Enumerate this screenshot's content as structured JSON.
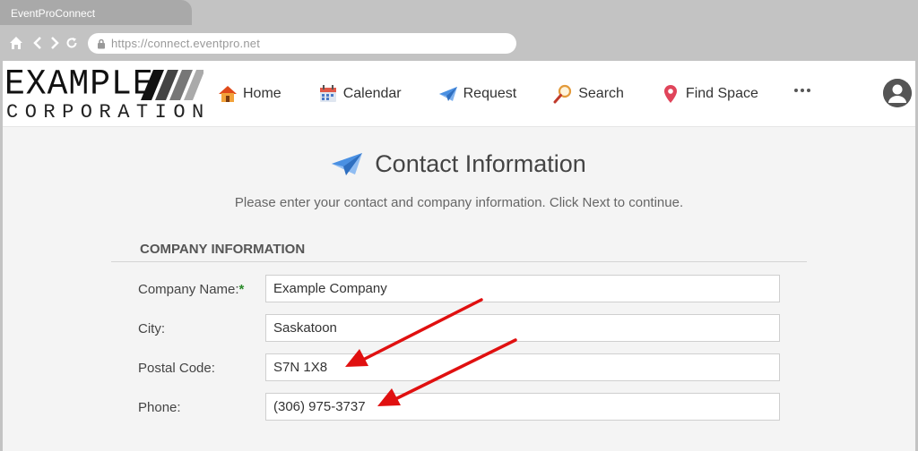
{
  "browser": {
    "tab_title": "EventProConnect",
    "url": "https://connect.eventpro.net"
  },
  "logo": {
    "line1": "EXAMPLE",
    "line2": "CORPORATION"
  },
  "nav": {
    "items": [
      {
        "label": "Home",
        "icon": "house-icon"
      },
      {
        "label": "Calendar",
        "icon": "calendar-icon"
      },
      {
        "label": "Request",
        "icon": "paper-plane-icon"
      },
      {
        "label": "Search",
        "icon": "magnifier-icon"
      },
      {
        "label": "Find Space",
        "icon": "map-pin-icon"
      }
    ],
    "more_icon": "ellipsis-icon",
    "avatar_icon": "user-avatar-icon"
  },
  "page": {
    "title": "Contact Information",
    "subtitle": "Please enter your contact and company information. Click Next to continue."
  },
  "section": {
    "title": "COMPANY INFORMATION"
  },
  "form": {
    "company_name": {
      "label": "Company Name:",
      "required_mark": "*",
      "value": "Example Company"
    },
    "city": {
      "label": "City:",
      "value": "Saskatoon"
    },
    "postal_code": {
      "label": "Postal Code:",
      "value": "S7N 1X8"
    },
    "phone": {
      "label": "Phone:",
      "value": "(306) 975-3737"
    }
  },
  "colors": {
    "accent_red": "#e01010",
    "required_green": "#2a8a2a",
    "plane_blue": "#4a90e2"
  }
}
